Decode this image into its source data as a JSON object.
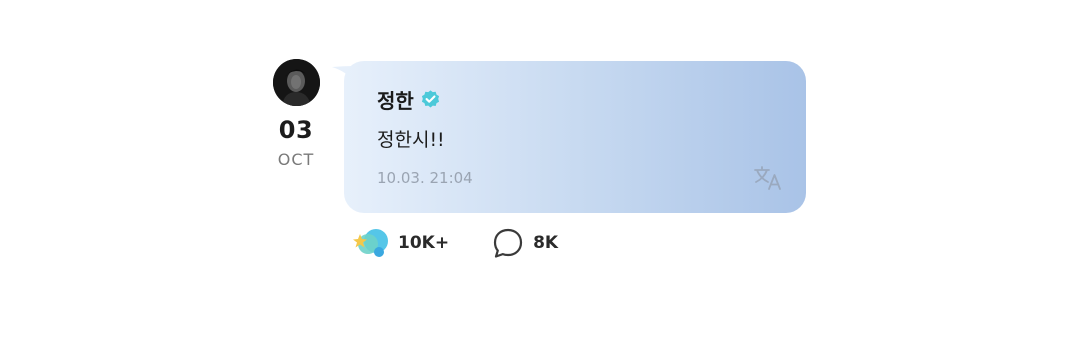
{
  "post": {
    "author": "정한",
    "message": "정한시!!",
    "timestamp": "10.03. 21:04",
    "date": {
      "day": "03",
      "month": "OCT"
    }
  },
  "reactions": {
    "likes": "10K+",
    "comments": "8K"
  },
  "icons": {
    "verified": "verified-badge-icon",
    "translate": "translate-icon",
    "like": "like-reaction-icon",
    "comment": "comment-bubble-icon"
  },
  "colors": {
    "verified": "#4cc9d9",
    "bubble_start": "#e7f0fb",
    "bubble_end": "#a9c3e7"
  }
}
